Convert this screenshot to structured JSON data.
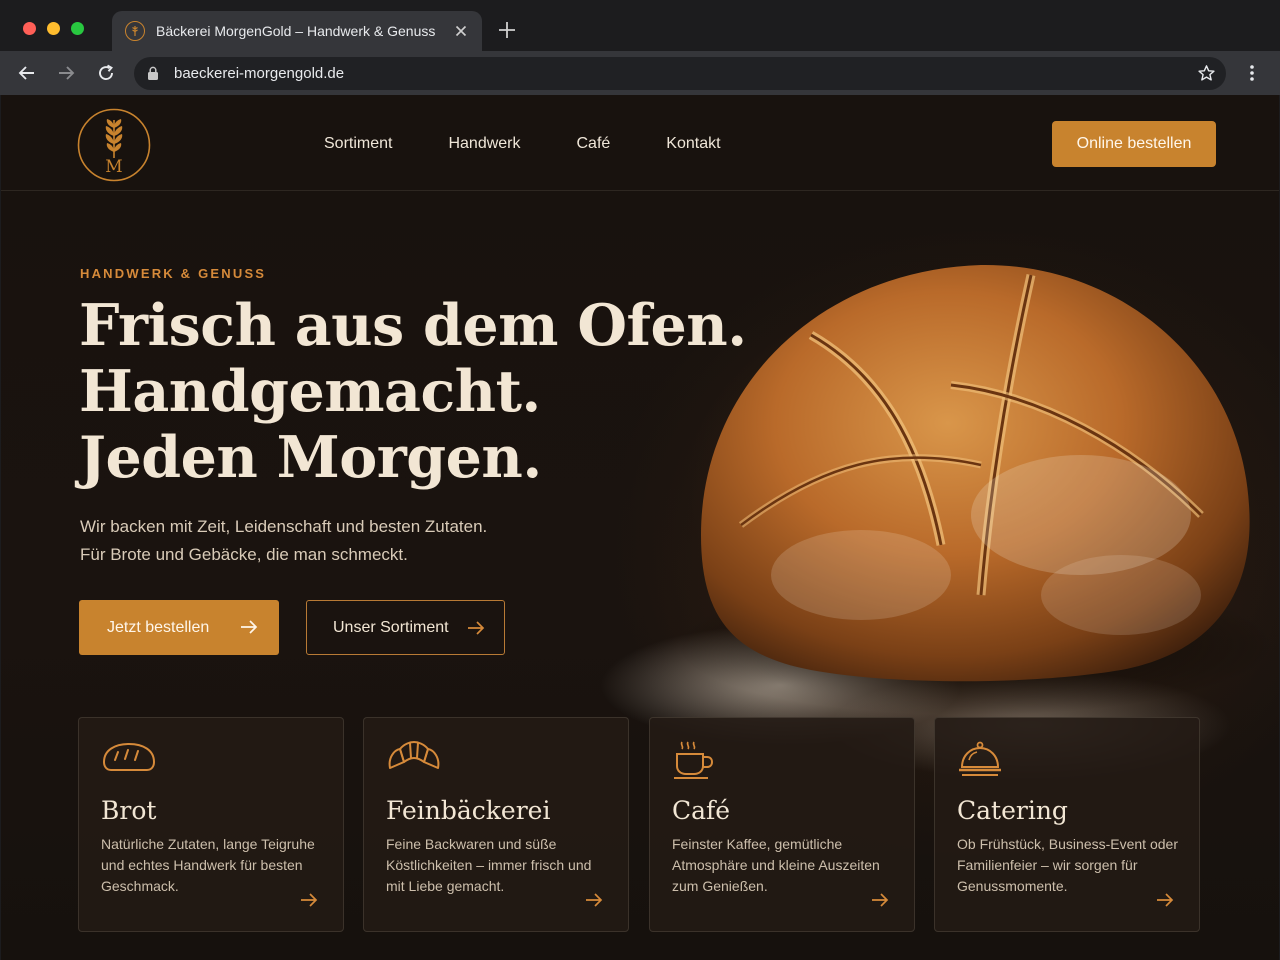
{
  "browser": {
    "tab_title": "Bäckerei MorgenGold – Handwerk & Genuss",
    "url": "baeckerei-morgengold.de",
    "icons": [
      "back-icon",
      "forward-icon",
      "reload-icon",
      "lock-icon",
      "star-icon",
      "menu-icon",
      "close-icon",
      "plus-icon"
    ]
  },
  "header": {
    "logo_letter": "M",
    "nav": [
      "Sortiment",
      "Handwerk",
      "Café",
      "Kontakt"
    ],
    "order_label": "Online bestellen"
  },
  "hero": {
    "eyebrow": "HANDWERK & GENUSS",
    "title_lines": [
      "Frisch aus dem Ofen.",
      "Handgemacht.",
      "Jeden Morgen."
    ],
    "text_lines": [
      "Wir backen mit Zeit, Leidenschaft und besten Zutaten.",
      "Für Brote und Gebäcke, die man schmeckt."
    ],
    "primary_label": "Jetzt bestellen",
    "secondary_label": "Unser Sortiment"
  },
  "cards": [
    {
      "title": "Brot",
      "desc": "Natürliche Zutaten, lange Teigruhe und echtes Handwerk für besten Geschmack.",
      "icon": "bread-icon"
    },
    {
      "title": "Feinbäckerei",
      "desc": "Feine Backwaren und süße Köstlichkeiten – immer frisch und mit Liebe gemacht.",
      "icon": "croissant-icon"
    },
    {
      "title": "Café",
      "desc": "Feinster Kaffee, gemütliche Atmosphäre und kleine Auszeiten zum Genießen.",
      "icon": "coffee-cup-icon"
    },
    {
      "title": "Catering",
      "desc": "Ob Frühstück, Business-Event oder Familienfeier – wir sorgen für Genussmomente.",
      "icon": "cloche-icon"
    }
  ],
  "colors": {
    "accent": "#c8832e",
    "background": "#18120e",
    "heading": "#f2e6d4"
  }
}
